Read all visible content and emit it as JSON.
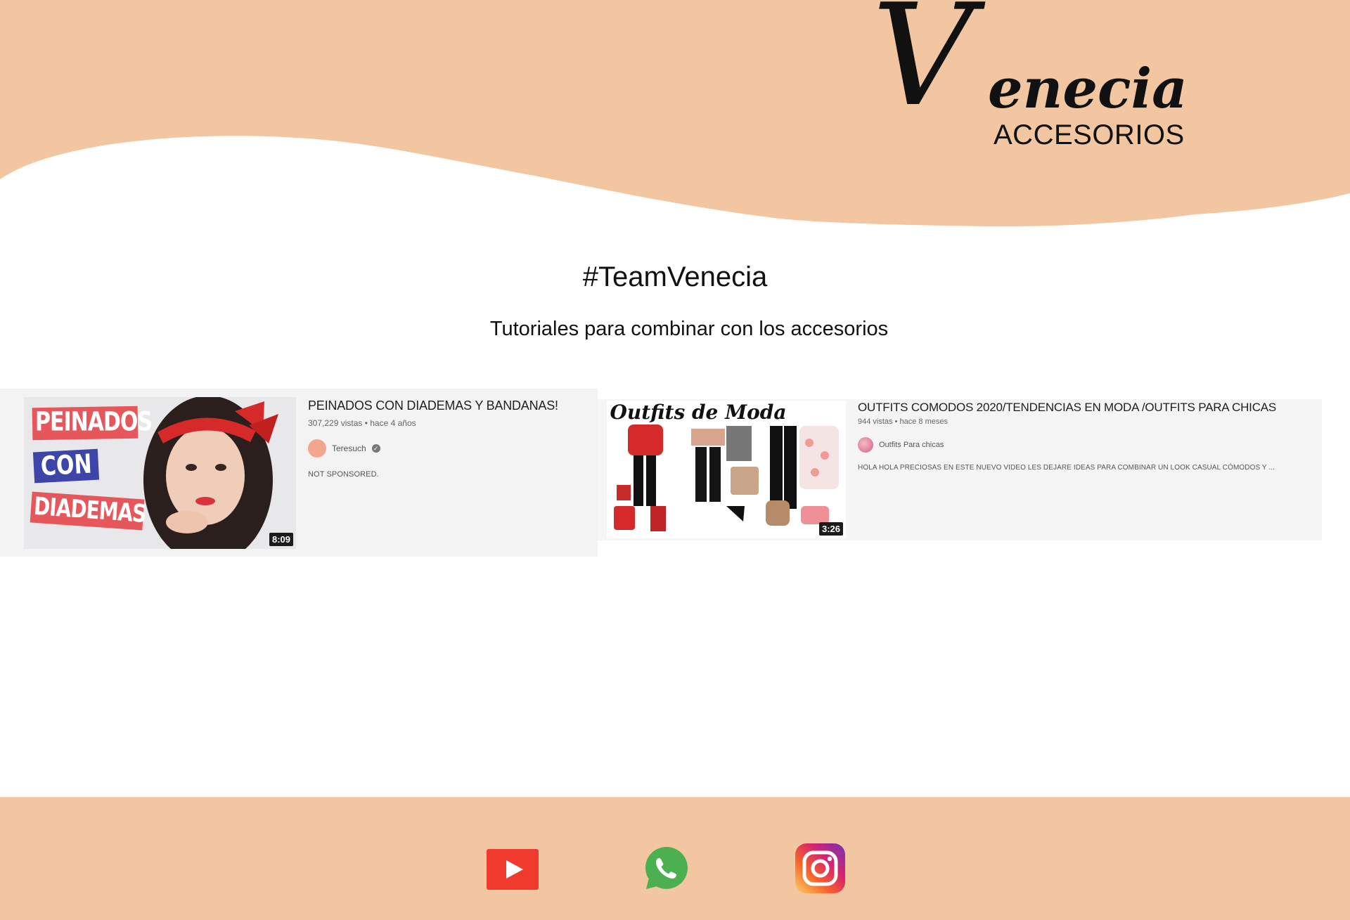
{
  "brand": {
    "script_initial": "V",
    "script_rest": "enecia",
    "subtitle": "ACCESORIOS"
  },
  "colors": {
    "header_peach": "#f1c6a1",
    "footer_peach": "#f1c6a1",
    "youtube_red": "#f03a2e",
    "whatsapp_green": "#4caf50"
  },
  "section": {
    "title": "#TeamVenecia",
    "subtitle": "Tutoriales para combinar con los accesorios"
  },
  "videos": [
    {
      "title": "PEINADOS CON DIADEMAS Y BANDANAS!",
      "meta": "307,229 vistas • hace 4 años",
      "channel": "Teresuch",
      "description": "NOT SPONSORED.",
      "duration": "8:09",
      "thumb_words": [
        "PEINADOS",
        "CON",
        "DIADEMAS"
      ]
    },
    {
      "title": "OUTFITS COMODOS 2020/TENDENCIAS EN MODA /OUTFITS PARA CHICAS",
      "meta": "944 vistas • hace 8 meses",
      "channel": "Outfits Para chicas",
      "description": "HOLA HOLA PRECIOSAS EN ESTE NUEVO VIDEO LES DEJARE IDEAS PARA COMBINAR UN LOOK CASUAL CÓMODOS Y ...",
      "duration": "3:26",
      "thumb_title": "Outfits de Moda"
    }
  ],
  "social": [
    {
      "icon": "youtube-icon"
    },
    {
      "icon": "whatsapp-icon"
    },
    {
      "icon": "instagram-icon"
    }
  ]
}
